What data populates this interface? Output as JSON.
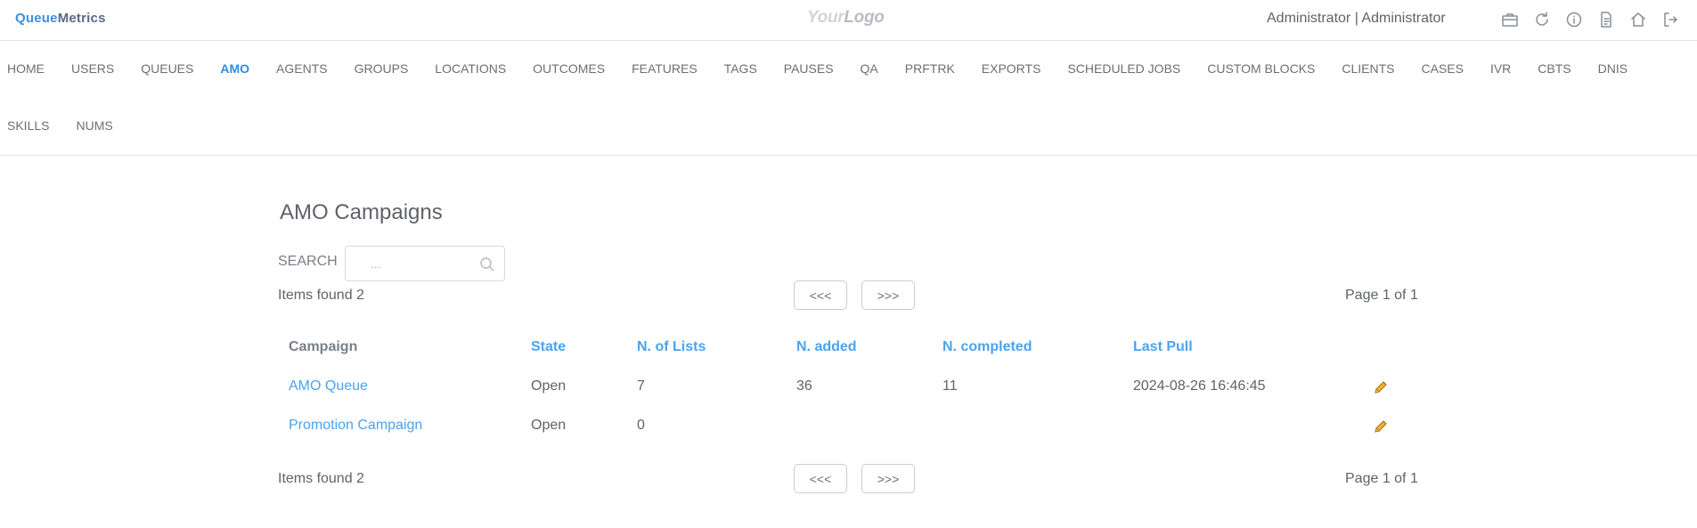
{
  "header": {
    "brand_part1": "Queue",
    "brand_part2": "Metrics",
    "logo_part1": "Your",
    "logo_part2": "Logo",
    "user": "Administrator | Administrator",
    "icons": [
      "briefcase-icon",
      "refresh-icon",
      "info-icon",
      "document-icon",
      "home-icon",
      "logout-icon"
    ]
  },
  "nav": {
    "row1": [
      "HOME",
      "USERS",
      "QUEUES",
      "AMO",
      "AGENTS",
      "GROUPS",
      "LOCATIONS",
      "OUTCOMES",
      "FEATURES",
      "TAGS",
      "PAUSES",
      "QA",
      "PRFTRK",
      "EXPORTS",
      "SCHEDULED JOBS",
      "CUSTOM BLOCKS",
      "CLIENTS",
      "CASES",
      "IVR",
      "CBTS",
      "DNIS"
    ],
    "row2": [
      "SKILLS",
      "NUMS"
    ],
    "active": "AMO"
  },
  "main": {
    "title": "AMO Campaigns",
    "search_label": "SEARCH",
    "search_placeholder": "...",
    "search_value": "",
    "items_found": "Items found 2",
    "prev_label": "<<<",
    "next_label": ">>>",
    "page_info": "Page 1 of 1"
  },
  "table": {
    "columns": [
      "Campaign",
      "State",
      "N. of Lists",
      "N. added",
      "N. completed",
      "Last Pull"
    ],
    "rows": [
      {
        "campaign": "AMO Queue",
        "state": "Open",
        "lists": "7",
        "added": "36",
        "completed": "11",
        "last_pull": "2024-08-26 16:46:45"
      },
      {
        "campaign": "Promotion Campaign",
        "state": "Open",
        "lists": "0",
        "added": "",
        "completed": "",
        "last_pull": ""
      }
    ]
  },
  "colors": {
    "accent": "#2b8de6",
    "link": "#4aa3f0",
    "text": "#5f6368",
    "edit_icon": "#e8a317"
  }
}
